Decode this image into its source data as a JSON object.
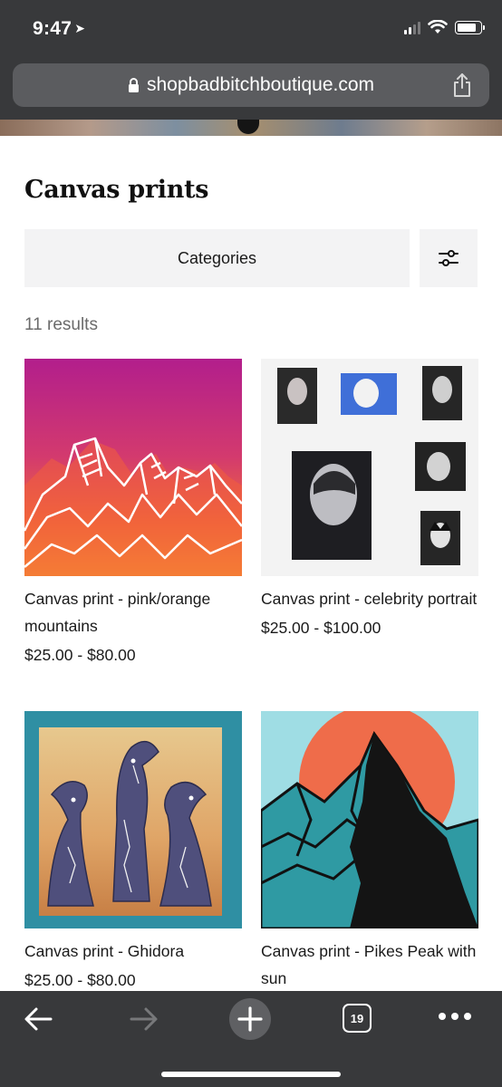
{
  "status_bar": {
    "time": "9:47",
    "location_icon": "location-arrow-icon",
    "signal_icon": "cell-signal-icon",
    "wifi_icon": "wifi-icon",
    "battery_icon": "battery-icon",
    "battery_level": 0.85
  },
  "browser": {
    "url": "shopbadbitchboutique.com",
    "lock_icon": "lock-icon",
    "share_icon": "share-icon",
    "tab_count": "19"
  },
  "page": {
    "title": "Canvas prints",
    "categories_label": "Categories",
    "filter_icon": "sliders-icon",
    "results": "11 results"
  },
  "products": [
    {
      "name": "Canvas print - pink/orange mountains",
      "price": "$25.00 - $80.00"
    },
    {
      "name": "Canvas print - celebrity portrait",
      "price": "$25.00 - $100.00"
    },
    {
      "name": "Canvas print - Ghidora",
      "price": "$25.00 - $80.00"
    },
    {
      "name": "Canvas print - Pikes Peak with sun",
      "price": ""
    }
  ],
  "toolbar": {
    "back_icon": "arrow-left-icon",
    "forward_icon": "arrow-right-icon",
    "new_tab_icon": "plus-icon",
    "tabs_icon": "tabs-icon",
    "more_icon": "ellipsis-icon"
  },
  "colors": {
    "chrome": "#38393b",
    "url_bar": "#5b5c5f",
    "button_bg": "#f3f3f4"
  }
}
